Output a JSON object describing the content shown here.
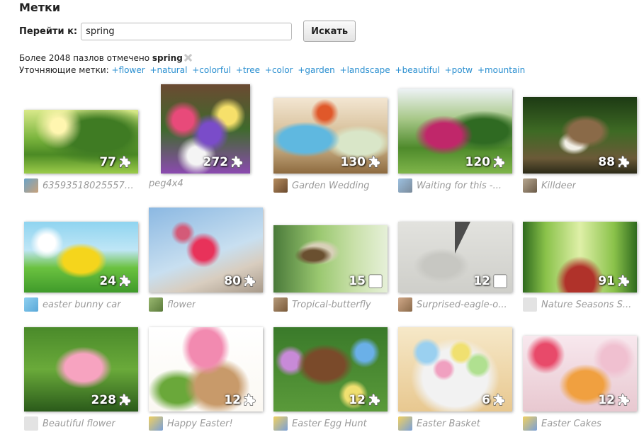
{
  "page": {
    "title": "Метки"
  },
  "search": {
    "label": "Перейти к:",
    "value": "spring",
    "button": "Искать"
  },
  "info": {
    "count_text": "Более 2048 пазлов отмечено ",
    "tag": "spring",
    "refine_label": "Уточняющие метки:",
    "refine_tags": [
      "+flower",
      "+natural",
      "+colorful",
      "+tree",
      "+color",
      "+garden",
      "+landscape",
      "+beautiful",
      "+potw",
      "+mountain"
    ]
  },
  "colors": {
    "link": "#2a8fd0",
    "caption": "#9a9a9a"
  },
  "puzzles": [
    {
      "pieces": "77",
      "caption": "635935180255574...",
      "piece_icon": "puzzle-piece-icon"
    },
    {
      "pieces": "272",
      "caption": "peg4x4",
      "piece_icon": "puzzle-piece-icon"
    },
    {
      "pieces": "130",
      "caption": "Garden Wedding",
      "piece_icon": "puzzle-piece-icon"
    },
    {
      "pieces": "120",
      "caption": "Waiting for this -...",
      "piece_icon": "puzzle-piece-icon"
    },
    {
      "pieces": "88",
      "caption": "Killdeer",
      "piece_icon": "puzzle-piece-icon"
    },
    {
      "pieces": "24",
      "caption": "easter bunny car",
      "piece_icon": "puzzle-piece-icon"
    },
    {
      "pieces": "80",
      "caption": "flower",
      "piece_icon": "puzzle-piece-icon"
    },
    {
      "pieces": "15",
      "caption": "Tropical-butterfly",
      "piece_icon": "square-piece-icon"
    },
    {
      "pieces": "12",
      "caption": "Surprised-eagle-o...",
      "piece_icon": "square-piece-icon"
    },
    {
      "pieces": "91",
      "caption": "Nature Seasons S...",
      "piece_icon": "puzzle-piece-icon"
    },
    {
      "pieces": "228",
      "caption": "Beautiful flower",
      "piece_icon": "puzzle-piece-icon"
    },
    {
      "pieces": "12",
      "caption": "Happy Easter!",
      "piece_icon": "puzzle-piece-icon"
    },
    {
      "pieces": "12",
      "caption": "Easter Egg Hunt",
      "piece_icon": "puzzle-piece-icon"
    },
    {
      "pieces": "6",
      "caption": "Easter Basket",
      "piece_icon": "puzzle-piece-icon"
    },
    {
      "pieces": "12",
      "caption": "Easter Cakes",
      "piece_icon": "puzzle-piece-icon"
    }
  ]
}
